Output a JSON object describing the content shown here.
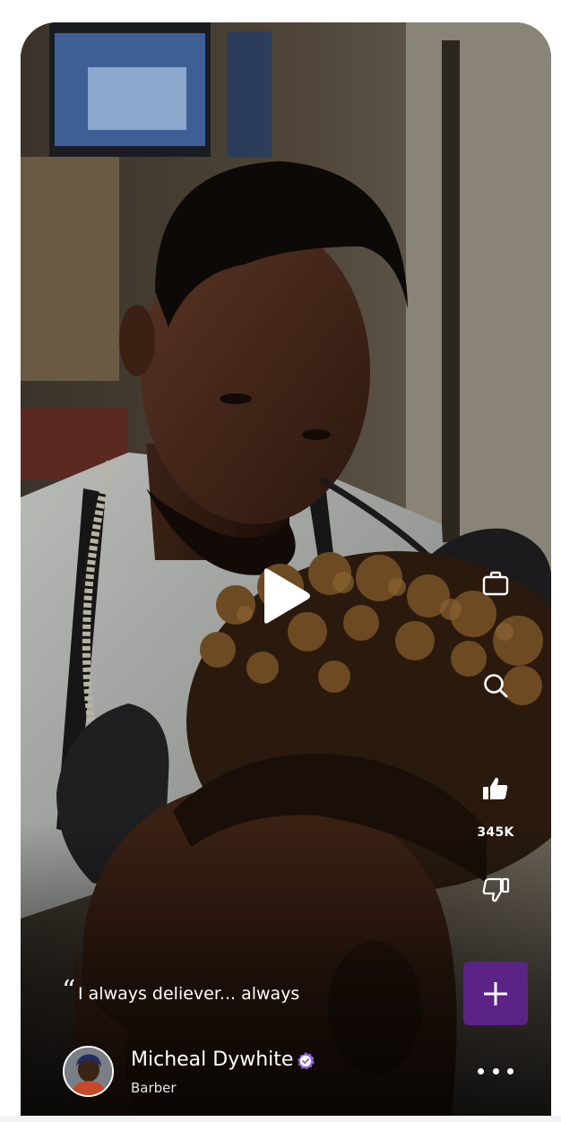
{
  "post": {
    "quote_mark": "“",
    "caption": "I always deliever... always"
  },
  "profile": {
    "name": "Micheal Dywhite",
    "role": "Barber"
  },
  "actions": {
    "like_count": "345K",
    "icons": [
      "briefcase-icon",
      "search-icon",
      "thumbs-up-icon",
      "thumbs-down-icon",
      "plus-icon",
      "more-icon",
      "play-icon"
    ]
  },
  "colors": {
    "accent": "#5b2385",
    "verified": "#8e5bd1",
    "icon": "#ffffff"
  }
}
